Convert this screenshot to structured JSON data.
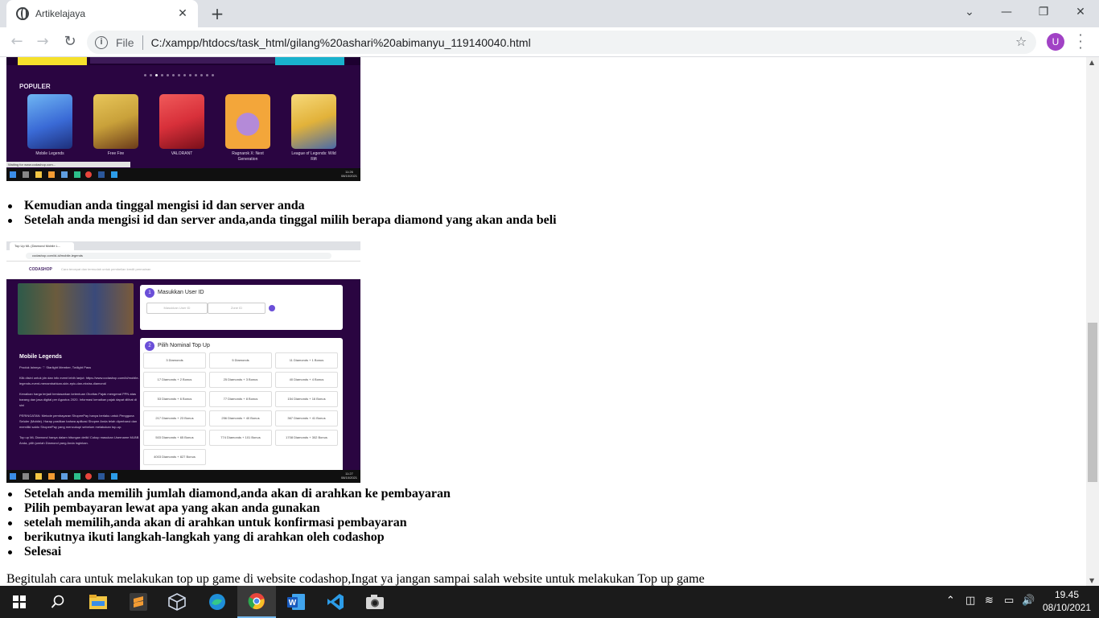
{
  "browser": {
    "tab_title": "Artikelajaya",
    "file_label": "File",
    "url": "C:/xampp/htdocs/task_html/gilang%20ashari%20abimanyu_119140040.html",
    "avatar_letter": "U",
    "avatar_color": "#a142c5"
  },
  "screenshot1": {
    "section_label": "POPULER",
    "games": [
      {
        "name": "Mobile Legends",
        "color": "#3a6ad6"
      },
      {
        "name": "Free Fire",
        "color": "#c9a13a"
      },
      {
        "name": "VALORANT",
        "color": "#d8303a"
      },
      {
        "name": "Ragnarok X: Next Generation",
        "color": "#f3a63a"
      },
      {
        "name": "League of Legends: Wild Rift",
        "color": "#e2b23a"
      }
    ],
    "status_text": "Waiting for www.codashop.com...",
    "clock_time": "11:26",
    "clock_date": "08/10/2021"
  },
  "steps_a": [
    "Kemudian anda tinggal mengisi id dan server anda",
    "Setelah anda mengisi id dan server anda,anda tinggal milih berapa diamond yang akan anda beli"
  ],
  "screenshot2": {
    "tab_title": "Top Up ML (Diamond Mobile L...",
    "url": "codashop.com/id-id/mobile-legends",
    "logo": "CODASHOP",
    "search_placeholder": "Cara tercepat dan termudah untuk pembelian kredit permainan",
    "game_title": "Mobile Legends",
    "desc": [
      "Produk lainnya: ♡ Starlight Member, Twilight Pass",
      "Klik disini untuk jdn dan info event lebih lanjut: https://www.codashop.com/id/mobile-legends-event-menambahkan-skin-epic-dan-ekstra-diamond/",
      "Kenaikan harga terjadi berdasarkan ketentuan Otoritas Pajak mengenai PPN atas barang dan jasa digital per Agustus 2020. Informasi kenaikan pajak dapat dilihat di sini",
      "PERINGATAN: Metode pembayaran ShopeePay hanya berlaku untuk Pengguna Seluler (Mobile). Harap pastikan bahwa aplikasi Shopee Anda telah diperbarui dan memiliki saldo ShopeePay yang mencukupi sebelum melakukan top-up.",
      "Top up ML Diamond hanya dalam hitungan detik! Cukup masukan Username MLBB Anda, pilih jumlah Diamond yang Anda inginkan."
    ],
    "step1": {
      "num": "1",
      "title": "Masukkan User ID",
      "user_placeholder": "Masukkan User ID",
      "zone_placeholder": "Zone ID"
    },
    "step2": {
      "num": "2",
      "title": "Pilih Nominal Top Up",
      "options": [
        "3 Diamonds",
        "5 Diamonds",
        "11 Diamonds + 1 Bonus",
        "17 Diamonds + 2 Bonus",
        "25 Diamonds + 3 Bonus",
        "40 Diamonds + 4 Bonus",
        "53 Diamonds + 6 Bonus",
        "77 Diamonds + 8 Bonus",
        "154 Diamonds + 16 Bonus",
        "217 Diamonds + 23 Bonus",
        "256 Diamonds + 40 Bonus",
        "367 Diamonds + 41 Bonus",
        "503 Diamonds + 65 Bonus",
        "774 Diamonds + 101 Bonus",
        "1708 Diamonds + 302 Bonus",
        "4003 Diamonds + 827 Bonus"
      ]
    },
    "clock_time": "11:27",
    "clock_date": "08/10/2021"
  },
  "steps_b": [
    "Setelah anda memilih jumlah diamond,anda akan di arahkan ke pembayaran",
    "Pilih pembayaran lewat apa yang akan anda gunakan",
    "setelah memilih,anda akan di arahkan untuk konfirmasi pembayaran",
    "berikutnya ikuti langkah-langkah yang di arahkan oleh codashop",
    "Selesai"
  ],
  "closing_paragraph": "Begitulah cara untuk melakukan top up game di website codashop,Ingat ya jangan sampai salah website untuk melakukan Top up game",
  "taskbar": {
    "time": "19.45",
    "date": "08/10/2021",
    "apps": [
      "start-icon",
      "search-icon",
      "file-explorer-icon",
      "sublime-text-icon",
      "virtualbox-icon",
      "edge-icon",
      "chrome-icon",
      "word-icon",
      "vscode-icon",
      "camera-icon"
    ]
  }
}
